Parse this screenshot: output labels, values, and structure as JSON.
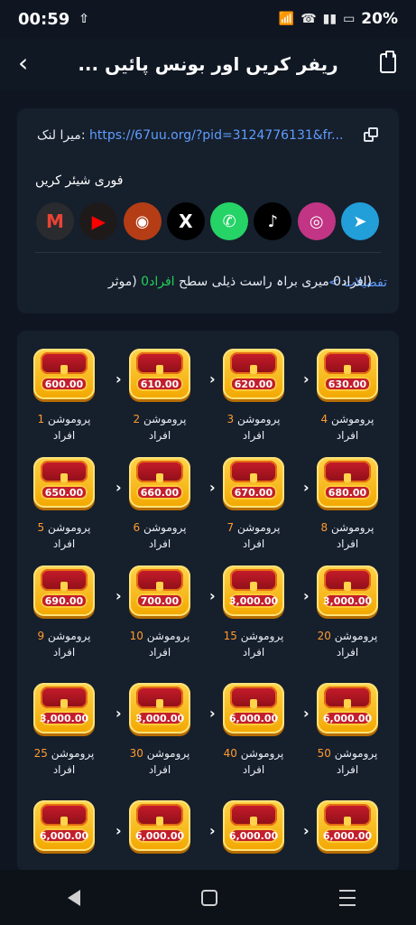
{
  "status": {
    "time": "00:59",
    "battery": "20%"
  },
  "header": {
    "title": "ریفر کریں اور بونس پائیں ..."
  },
  "link": {
    "label": "میرا لنک:",
    "value": "https://67uu.org/?pid=3124776131&fr..."
  },
  "share": {
    "label": "فوری شیئر کریں",
    "items": [
      "gmail-icon",
      "youtube-icon",
      "kuaishou-icon",
      "x-icon",
      "whatsapp-icon",
      "tiktok-icon",
      "instagram-icon",
      "telegram-icon"
    ]
  },
  "details": {
    "label": "تفصیلات >"
  },
  "condition": {
    "prefix": "(افراد",
    "mid": "0 میری براہ راست ذیلی سطح ",
    "green": "افراد0",
    "suffix": " (موثر"
  },
  "rewards": [
    {
      "amount": "600.00",
      "count": "1",
      "label_after": "افراد"
    },
    {
      "amount": "610.00",
      "count": "2",
      "label_after": "افراد"
    },
    {
      "amount": "620.00",
      "count": "3",
      "label_after": "افراد"
    },
    {
      "amount": "630.00",
      "count": "4",
      "label_after": "افراد"
    },
    {
      "amount": "650.00",
      "count": "5",
      "label_after": "افراد"
    },
    {
      "amount": "660.00",
      "count": "6",
      "label_after": "افراد"
    },
    {
      "amount": "670.00",
      "count": "7",
      "label_after": "افراد"
    },
    {
      "amount": "680.00",
      "count": "8",
      "label_after": "افراد"
    },
    {
      "amount": "690.00",
      "count": "9",
      "label_after": "افراد"
    },
    {
      "amount": "700.00",
      "count": "10",
      "label_after": "افراد"
    },
    {
      "amount": "3,000.00",
      "count": "15",
      "label_after": "افراد"
    },
    {
      "amount": "3,000.00",
      "count": "20",
      "label_after": "افراد"
    },
    {
      "amount": "3,000.00",
      "count": "25",
      "label_after": "افراد"
    },
    {
      "amount": "3,000.00",
      "count": "30",
      "label_after": "افراد"
    },
    {
      "amount": "6,000.00",
      "count": "40",
      "label_after": "افراد"
    },
    {
      "amount": "6,000.00",
      "count": "50",
      "label_after": "افراد"
    },
    {
      "amount": "6,000.00",
      "count": "",
      "label_after": ""
    },
    {
      "amount": "6,000.00",
      "count": "",
      "label_after": ""
    },
    {
      "amount": "6,000.00",
      "count": "",
      "label_after": ""
    },
    {
      "amount": "6,000.00",
      "count": "",
      "label_after": ""
    }
  ]
}
